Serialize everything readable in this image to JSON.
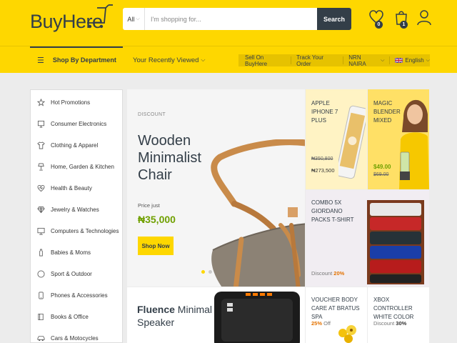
{
  "brand": {
    "name_part1": "Buy",
    "name_part2": "Here"
  },
  "search": {
    "category": "All",
    "placeholder": "I'm shopping for...",
    "button": "Search"
  },
  "header_icons": {
    "wishlist_count": "0",
    "cart_count": "1"
  },
  "navbar": {
    "shop_by_department": "Shop By Department",
    "recently_viewed": "Your Recently Viewed",
    "links": [
      "Sell On BuyHere",
      "Track Your Order",
      "NRN NAIRA",
      "English"
    ]
  },
  "sidebar": {
    "items": [
      {
        "label": "Hot Promotions",
        "icon": "star-icon"
      },
      {
        "label": "Consumer Electronics",
        "icon": "monitor-icon"
      },
      {
        "label": "Clothing & Apparel",
        "icon": "shirt-icon"
      },
      {
        "label": "Home, Garden & Kitchen",
        "icon": "lamp-icon"
      },
      {
        "label": "Health & Beauty",
        "icon": "heart-icon"
      },
      {
        "label": "Jewelry & Watches",
        "icon": "diamond-icon"
      },
      {
        "label": "Computers & Technologies",
        "icon": "desktop-icon"
      },
      {
        "label": "Babies & Moms",
        "icon": "bottle-icon"
      },
      {
        "label": "Sport & Outdoor",
        "icon": "ball-icon"
      },
      {
        "label": "Phones & Accessories",
        "icon": "phone-icon"
      },
      {
        "label": "Books & Office",
        "icon": "book-icon"
      },
      {
        "label": "Cars & Motocycles",
        "icon": "car-icon"
      }
    ]
  },
  "hero": {
    "badge": "DISCOUNT",
    "title": "Wooden Minimalist Chair",
    "price_prefix": "Price just",
    "price": "₦35,000",
    "button": "Shop Now"
  },
  "tiles": {
    "iphone": {
      "title": "Apple iPhone 7 Plus",
      "old_price": "₦350,800",
      "new_price": "₦273,500"
    },
    "blender": {
      "title": "Magic Blender Mixed",
      "new_price": "$49.00",
      "old_price": "$69.00"
    },
    "shirt": {
      "title": "Combo 5X Giordano Packs T-Shirt",
      "discount_label": "Discount",
      "discount_value": "20%"
    },
    "speaker": {
      "title_bold": "Fluence",
      "title_rest": "Minimal",
      "title_line2": "Speaker"
    },
    "voucher": {
      "title": "Voucher Body Care at Bratus Spa",
      "discount_value": "25%",
      "discount_label": "Off"
    },
    "xbox": {
      "title": "Xbox Controller White Color",
      "discount_label": "Discount",
      "discount_value": "30%"
    }
  },
  "colors": {
    "brand_yellow": "#fed700",
    "dark": "#333e48",
    "price_green": "#70a000",
    "discount_orange": "#e37200"
  }
}
